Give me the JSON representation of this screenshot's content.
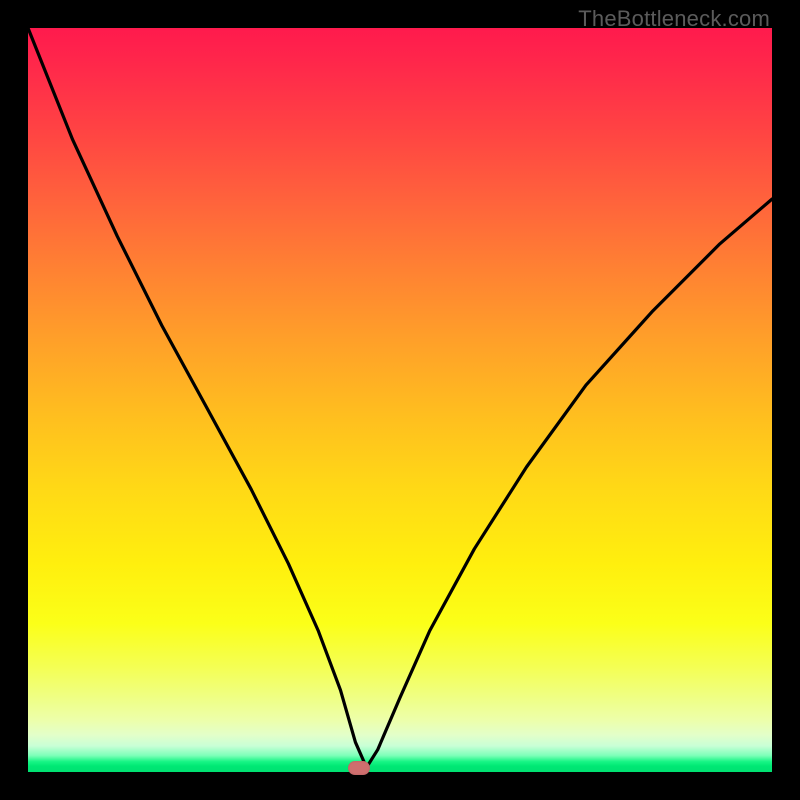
{
  "watermark": "TheBottleneck.com",
  "marker": {
    "x_pct": 44.5,
    "y_pct": 99.4
  },
  "chart_data": {
    "type": "line",
    "title": "",
    "xlabel": "",
    "ylabel": "",
    "xlim": [
      0,
      100
    ],
    "ylim": [
      0,
      100
    ],
    "series": [
      {
        "name": "curve",
        "x": [
          0,
          6,
          12,
          18,
          24,
          30,
          35,
          39,
          42,
          44,
          45.5,
          47,
          50,
          54,
          60,
          67,
          75,
          84,
          93,
          100
        ],
        "y": [
          100,
          85,
          72,
          60,
          49,
          38,
          28,
          19,
          11,
          4,
          0.6,
          3,
          10,
          19,
          30,
          41,
          52,
          62,
          71,
          77
        ]
      }
    ],
    "marker_point": {
      "x": 45.5,
      "y": 0.6
    },
    "background_gradient": {
      "top": "#ff1a4d",
      "mid": "#ffd916",
      "bottom": "#00e172"
    }
  }
}
